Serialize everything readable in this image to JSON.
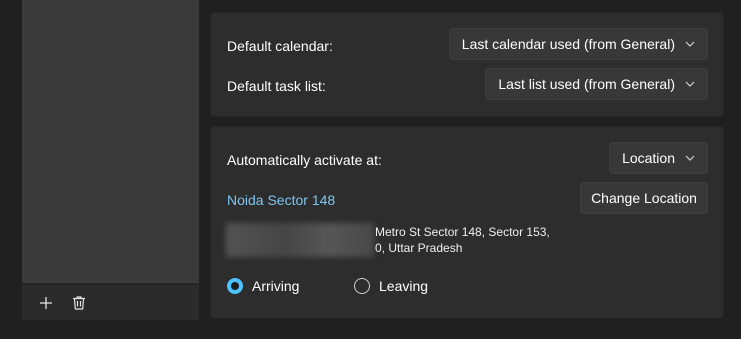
{
  "calendar_settings": {
    "default_calendar_label": "Default calendar:",
    "default_calendar_value": "Last calendar used (from General)",
    "default_task_list_label": "Default task list:",
    "default_task_list_value": "Last list used (from General)"
  },
  "activation": {
    "label": "Automatically activate at:",
    "mode_value": "Location",
    "location_name": "Noida Sector 148",
    "change_location_label": "Change Location",
    "address_line1": "Metro St Sector 148, Sector 153,",
    "address_line2": "0, Uttar Pradesh",
    "arriving_label": "Arriving",
    "leaving_label": "Leaving",
    "selected_trigger": "Arriving"
  },
  "sidebar": {
    "footer_icons": [
      "plus-icon",
      "trash-icon"
    ]
  },
  "colors": {
    "accent": "#4cc2ff",
    "link": "#7fc4f0",
    "card": "#2d2d2d",
    "background": "#202020"
  }
}
